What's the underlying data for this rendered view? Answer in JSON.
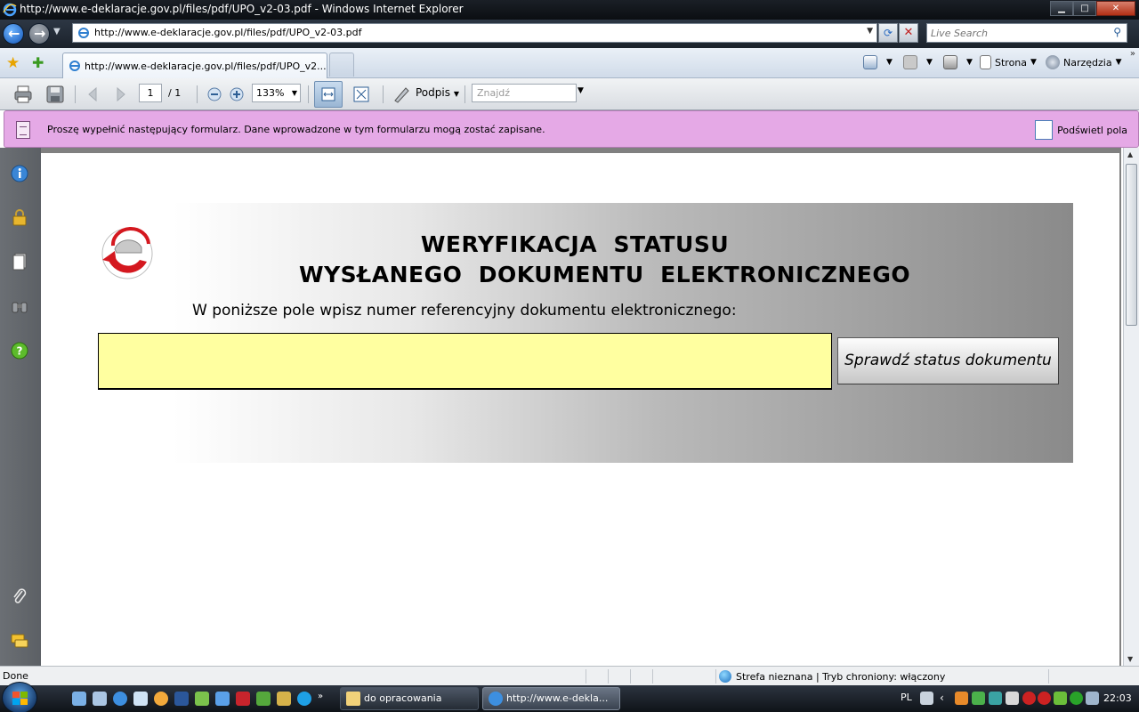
{
  "window": {
    "title": "http://www.e-deklaracje.gov.pl/files/pdf/UPO_v2-03.pdf - Windows Internet Explorer",
    "controls": {
      "minimize": "▁",
      "maximize": "□",
      "close": "✕"
    }
  },
  "address_bar": {
    "url": "http://www.e-deklaracje.gov.pl/files/pdf/UPO_v2-03.pdf",
    "search_placeholder": "Live Search"
  },
  "tabs": {
    "active_label": "http://www.e-deklaracje.gov.pl/files/pdf/UPO_v2..."
  },
  "command_bar": {
    "page_label": "Strona",
    "tools_label": "Narzędzia"
  },
  "pdf_toolbar": {
    "current_page": "1",
    "page_total": "/ 1",
    "zoom": "133%",
    "sign_label": "Podpis",
    "find_placeholder": "Znajdź"
  },
  "form_bar": {
    "message": "Proszę wypełnić następujący formularz. Dane wprowadzone w tym formularzu mogą zostać zapisane.",
    "highlight_label": "Podświetl pola"
  },
  "document": {
    "heading_line1": "WERYFIKACJA  STATUSU",
    "heading_line2": "WYSŁANEGO  DOKUMENTU  ELEKTRONICZNEGO",
    "instruction": "W poniższe pole wpisz numer referencyjny dokumentu elektronicznego:",
    "reference_value": "",
    "check_button_label": "Sprawdź status dokumentu"
  },
  "status_bar": {
    "status": "Done",
    "zone": "Strefa nieznana | Tryb chroniony: włączony"
  },
  "taskbar": {
    "tasks": [
      {
        "label": "do opracowania",
        "active": false
      },
      {
        "label": "http://www.e-dekla...",
        "active": true
      }
    ],
    "language": "PL",
    "clock": "22:03"
  },
  "colors": {
    "form_bar_bg": "#e5a9e6",
    "field_bg": "#ffffa0",
    "logo_red": "#d4181f"
  }
}
